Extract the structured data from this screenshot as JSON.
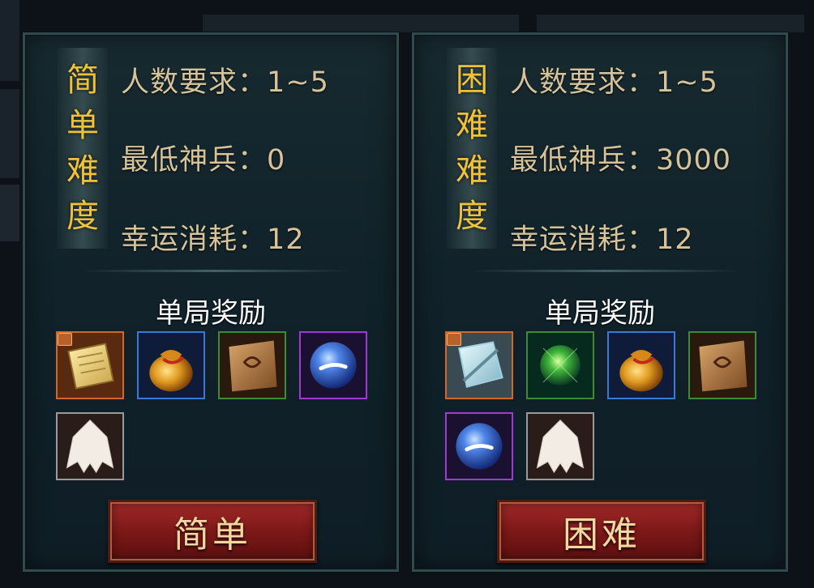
{
  "panels": [
    {
      "difficulty_chars": [
        "简",
        "单",
        "难",
        "度"
      ],
      "player_req": "人数要求：1~5",
      "min_weapon": "最低神兵：0",
      "luck_cost": "幸运消耗：12",
      "reward_title": "单局奖励",
      "rewards": [
        "scroll-item",
        "money-bag-item",
        "parchment-item",
        "blue-orb-item",
        "white-fur-item"
      ],
      "button_label": "简单"
    },
    {
      "difficulty_chars": [
        "困",
        "难",
        "难",
        "度"
      ],
      "player_req": "人数要求：1~5",
      "min_weapon": "最低神兵：3000",
      "luck_cost": "幸运消耗：12",
      "reward_title": "单局奖励",
      "rewards": [
        "ice-blade-item",
        "green-orb-item",
        "money-bag-item",
        "parchment-item",
        "blue-orb-item",
        "white-fur-item"
      ],
      "button_label": "困难"
    }
  ],
  "colors": {
    "difficulty_text": "#f0c23a",
    "info_text": "#d6c39a",
    "button_bg": "#8a1e1e",
    "button_text": "#f3d7a0",
    "quality_orange": "#d0682a",
    "quality_blue": "#3a7ad6",
    "quality_green": "#3f8a3a",
    "quality_purple": "#a03ad4"
  }
}
